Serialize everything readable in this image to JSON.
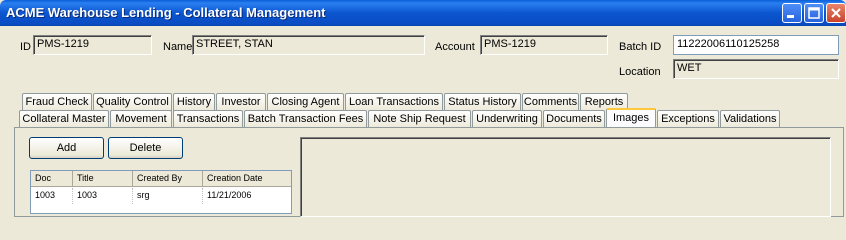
{
  "window": {
    "title": "ACME Warehouse Lending - Collateral Management"
  },
  "header": {
    "id_label": "ID",
    "id_value": "PMS-1219",
    "name_label": "Name",
    "name_value": "STREET, STAN",
    "account_label": "Account",
    "account_value": "PMS-1219",
    "batch_label": "Batch ID",
    "batch_value": "11222006110125258",
    "location_label": "Location",
    "location_value": "WET"
  },
  "tabs_row1": [
    "Fraud Check",
    "Quality Control",
    "History",
    "Investor",
    "Closing Agent",
    "Loan Transactions",
    "Status History",
    "Comments",
    "Reports"
  ],
  "tabs_row2": [
    "Collateral Master",
    "Movement",
    "Transactions",
    "Batch Transaction Fees",
    "Note Ship Request",
    "Underwriting",
    "Documents",
    "Images",
    "Exceptions",
    "Validations"
  ],
  "active_tab": "Images",
  "actions": {
    "add_label": "Add",
    "delete_label": "Delete"
  },
  "grid": {
    "columns": [
      "Doc",
      "Title",
      "Created By",
      "Creation Date"
    ],
    "rows": [
      [
        "1003",
        "1003",
        "srg",
        "11/21/2006"
      ]
    ]
  }
}
